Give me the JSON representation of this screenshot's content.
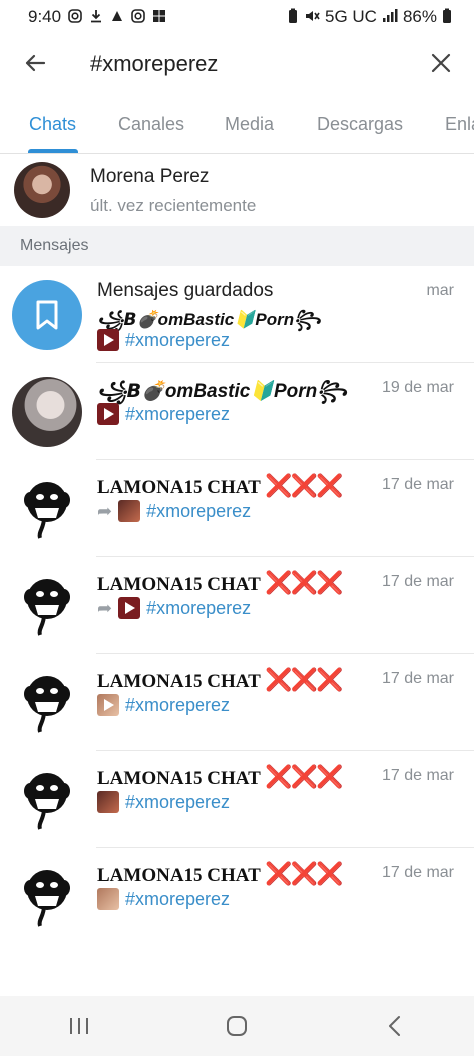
{
  "status_bar": {
    "time": "9:40",
    "left_icons": [
      "instagram-icon",
      "download-icon",
      "app-icon",
      "instagram-icon",
      "windows-icon"
    ],
    "network": "5G UC",
    "battery": "86%"
  },
  "header": {
    "search_value": "#xmoreperez"
  },
  "tabs": [
    {
      "label": "Chats",
      "active": true
    },
    {
      "label": "Canales",
      "active": false
    },
    {
      "label": "Media",
      "active": false
    },
    {
      "label": "Descargas",
      "active": false
    },
    {
      "label": "Enla",
      "active": false
    }
  ],
  "contact": {
    "name": "Morena Perez",
    "status": "últ. vez recientemente"
  },
  "section_title": "Mensajes",
  "messages": [
    {
      "title": "Mensajes guardados",
      "subtitle": "꧁𝘽💣omBastic🔰Porn꧂",
      "date": "mar",
      "preview": "#xmoreperez"
    },
    {
      "title": "꧁𝘽💣omBastic🔰Porn꧂",
      "date": "19 de mar",
      "preview": "#xmoreperez"
    },
    {
      "title": "LAMONA15 CHAT",
      "suffix": "❌❌❌",
      "date": "17 de mar",
      "preview": "#xmoreperez"
    },
    {
      "title": "LAMONA15 CHAT",
      "suffix": "❌❌❌",
      "date": "17 de mar",
      "preview": "#xmoreperez"
    },
    {
      "title": "LAMONA15 CHAT",
      "suffix": "❌❌❌",
      "date": "17 de mar",
      "preview": "#xmoreperez"
    },
    {
      "title": "LAMONA15 CHAT",
      "suffix": "❌❌❌",
      "date": "17 de mar",
      "preview": "#xmoreperez"
    },
    {
      "title": "LAMONA15 CHAT",
      "suffix": "❌❌❌",
      "date": "17 de mar",
      "preview": "#xmoreperez"
    }
  ],
  "colors": {
    "accent": "#2f8fd6",
    "hashtag": "#3a8ec9",
    "muted": "#8a8f94",
    "saved_avatar": "#4aa3e0"
  }
}
